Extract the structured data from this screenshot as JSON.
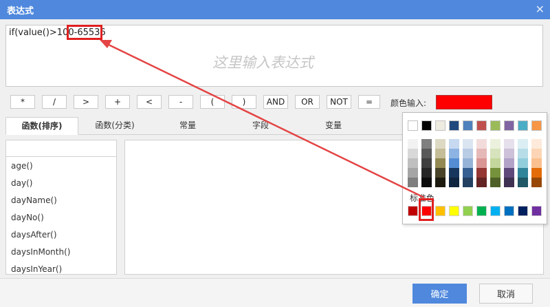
{
  "window": {
    "title": "表达式"
  },
  "expression": {
    "value_prefix": "if(value()>100",
    "value_highlight": "-65536",
    "placeholder": "这里输入表达式"
  },
  "operators": [
    "*",
    "/",
    ">",
    "+",
    "<",
    "-",
    "(",
    ")",
    "AND",
    "OR",
    "NOT",
    "="
  ],
  "color_input": {
    "label": "颜色输入:",
    "value_color": "#ff0000"
  },
  "tabs": [
    "函数(排序)",
    "函数(分类)",
    "常量",
    "字段",
    "变量"
  ],
  "function_list": [
    "age()",
    "day()",
    "dayName()",
    "dayNo()",
    "daysAfter()",
    "daysInMonth()",
    "daysInYear()"
  ],
  "color_picker": {
    "top_row": [
      "#ffffff",
      "#000000",
      "#eeece1",
      "#1f497d",
      "#4f81bd",
      "#c0504d",
      "#9bbb59",
      "#8064a2",
      "#4bacc6",
      "#f79646"
    ],
    "shade_columns": [
      [
        "#f2f2f2",
        "#d8d8d8",
        "#bfbfbf",
        "#a5a5a5",
        "#7f7f7f"
      ],
      [
        "#7f7f7f",
        "#595959",
        "#3f3f3f",
        "#262626",
        "#0c0c0c"
      ],
      [
        "#ddd9c3",
        "#c4bd97",
        "#938953",
        "#494429",
        "#1d1b10"
      ],
      [
        "#c6d9f0",
        "#8db3e2",
        "#548dd4",
        "#17365d",
        "#0f243e"
      ],
      [
        "#dbe5f1",
        "#b8cce4",
        "#95b3d7",
        "#366092",
        "#244061"
      ],
      [
        "#f2dcdb",
        "#e5b9b7",
        "#d99694",
        "#953734",
        "#632423"
      ],
      [
        "#ebf1dd",
        "#d7e3bc",
        "#c3d69b",
        "#76923c",
        "#4f6128"
      ],
      [
        "#e5e0ec",
        "#ccc1d9",
        "#b2a2c7",
        "#5f497a",
        "#3f3151"
      ],
      [
        "#dbeef3",
        "#b7dde8",
        "#92cddc",
        "#31859b",
        "#205867"
      ],
      [
        "#fdeada",
        "#fbd5b5",
        "#fac08f",
        "#e36c09",
        "#974806"
      ]
    ],
    "standard_label": "标准色",
    "standard_colors": [
      "#c00000",
      "#ff0000",
      "#ffc000",
      "#ffff00",
      "#92d050",
      "#00b050",
      "#00b0f0",
      "#0070c0",
      "#002060",
      "#7030a0"
    ]
  },
  "footer": {
    "ok_label": "确定",
    "cancel_label": "取消"
  }
}
